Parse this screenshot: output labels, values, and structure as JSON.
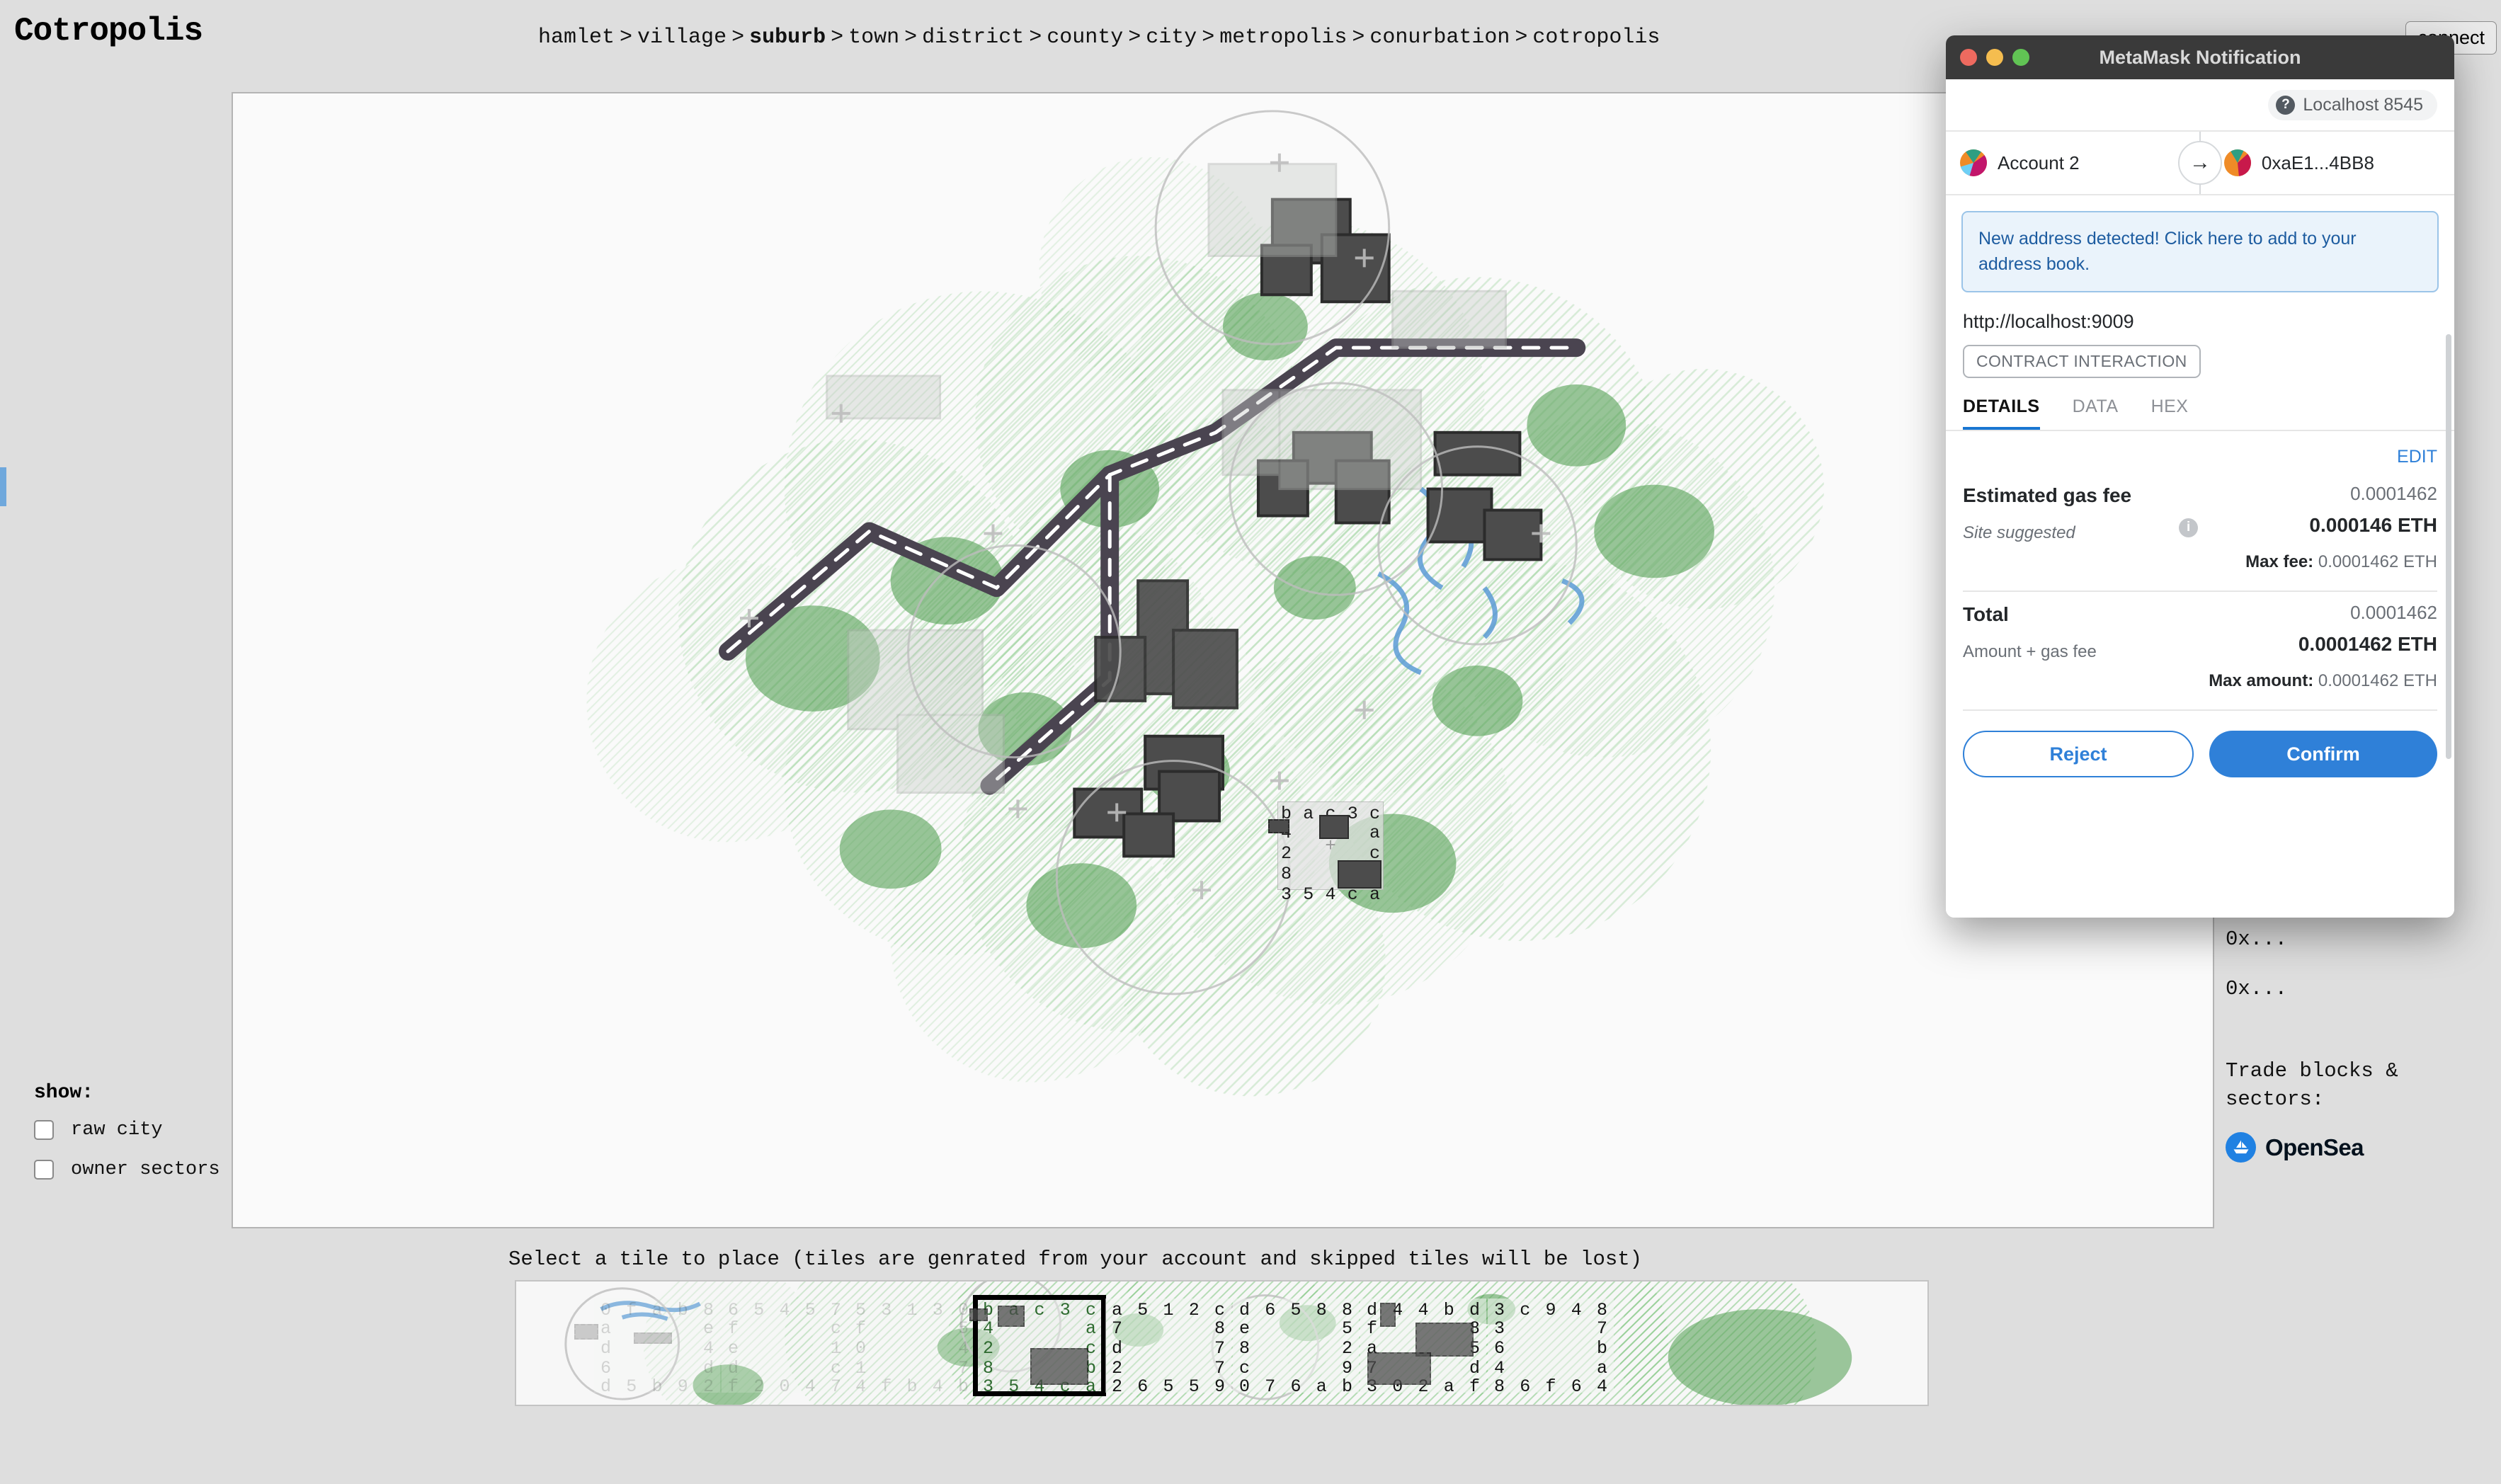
{
  "app": {
    "title": "Cotropolis",
    "connect_label": "connect"
  },
  "breadcrumb": {
    "separator": ">",
    "items": [
      {
        "label": "hamlet",
        "active": false
      },
      {
        "label": "village",
        "active": false
      },
      {
        "label": "suburb",
        "active": true
      },
      {
        "label": "town",
        "active": false
      },
      {
        "label": "district",
        "active": false
      },
      {
        "label": "county",
        "active": false
      },
      {
        "label": "city",
        "active": false
      },
      {
        "label": "metropolis",
        "active": false
      },
      {
        "label": "conurbation",
        "active": false
      },
      {
        "label": "cotropolis",
        "active": false
      }
    ]
  },
  "show_panel": {
    "label": "show:",
    "options": [
      {
        "label": "raw city",
        "checked": false
      },
      {
        "label": "owner sectors",
        "checked": false
      }
    ]
  },
  "right_sidebar": {
    "address_1": "0x...",
    "address_2": "0x...",
    "trade_label": "Trade blocks & sectors:",
    "marketplace": "OpenSea"
  },
  "map": {
    "overlay_tile": {
      "row_top": [
        "b",
        "a",
        "c",
        "3",
        "c"
      ],
      "row_2_left": "4",
      "row_2_right": "a",
      "row_3_left": "2",
      "row_3_right": "c",
      "row_4_left": "8",
      "row_4_right": "b",
      "row_bottom": [
        "3",
        "5",
        "4",
        "c",
        "a"
      ],
      "center_marker": "+"
    }
  },
  "tile_picker": {
    "hint": "Select a tile to place (tiles are genrated from your account and skipped tiles will be lost)",
    "tiles": [
      {
        "id": "tile-1",
        "state": "faded",
        "text_tone": "greytext",
        "row_top": [
          "0",
          "f",
          "a",
          "b",
          "8"
        ],
        "row_2_left": "a",
        "row_2_right": "e",
        "row_3_left": "d",
        "row_3_right": "4",
        "row_4_left": "6",
        "row_4_right": "d",
        "row_bottom": [
          "d",
          "5",
          "b",
          "9",
          "2"
        ]
      },
      {
        "id": "tile-2",
        "state": "faded",
        "text_tone": "greytext",
        "row_top": [
          "6",
          "5",
          "4",
          "5",
          "7"
        ],
        "row_2_left": "f",
        "row_2_right": "c",
        "row_3_left": "e",
        "row_3_right": "1",
        "row_4_left": "d",
        "row_4_right": "c",
        "row_bottom": [
          "f",
          "2",
          "0",
          "4",
          "7"
        ]
      },
      {
        "id": "tile-3",
        "state": "faded",
        "text_tone": "greytext",
        "row_top": [
          "5",
          "3",
          "1",
          "3",
          "0"
        ],
        "row_2_left": "f",
        "row_2_right": "5",
        "row_3_left": "0",
        "row_3_right": "4",
        "row_4_left": "1",
        "row_4_right": "7",
        "row_bottom": [
          "4",
          "f",
          "b",
          "4",
          "b"
        ]
      },
      {
        "id": "tile-4",
        "state": "selected",
        "text_tone": "greentext",
        "row_top": [
          "b",
          "a",
          "c",
          "3",
          "c"
        ],
        "row_2_left": "4",
        "row_2_right": "a",
        "row_3_left": "2",
        "row_3_right": "c",
        "row_4_left": "8",
        "row_4_right": "b",
        "row_bottom": [
          "3",
          "5",
          "4",
          "c",
          "a"
        ]
      },
      {
        "id": "tile-5",
        "state": "normal",
        "text_tone": "darktext",
        "row_top": [
          "a",
          "5",
          "1",
          "2",
          "c"
        ],
        "row_2_left": "7",
        "row_2_right": "8",
        "row_3_left": "d",
        "row_3_right": "7",
        "row_4_left": "2",
        "row_4_right": "7",
        "row_bottom": [
          "2",
          "6",
          "5",
          "5",
          "9"
        ]
      },
      {
        "id": "tile-6",
        "state": "normal",
        "text_tone": "darktext",
        "row_top": [
          "d",
          "6",
          "5",
          "8",
          "8"
        ],
        "row_2_left": "e",
        "row_2_right": "5",
        "row_3_left": "8",
        "row_3_right": "2",
        "row_4_left": "c",
        "row_4_right": "9",
        "row_bottom": [
          "0",
          "7",
          "6",
          "a",
          "b"
        ]
      },
      {
        "id": "tile-7",
        "state": "normal",
        "text_tone": "darktext",
        "row_top": [
          "d",
          "4",
          "4",
          "b",
          "d"
        ],
        "row_2_left": "f",
        "row_2_right": "8",
        "row_3_left": "a",
        "row_3_right": "5",
        "row_4_left": "7",
        "row_4_right": "d",
        "row_bottom": [
          "3",
          "0",
          "2",
          "a",
          "f"
        ]
      },
      {
        "id": "tile-8",
        "state": "normal",
        "text_tone": "darktext",
        "row_top": [
          "3",
          "c",
          "9",
          "4",
          "8"
        ],
        "row_2_left": "3",
        "row_2_right": "7",
        "row_3_left": "6",
        "row_3_right": "b",
        "row_4_left": "4",
        "row_4_right": "a",
        "row_bottom": [
          "8",
          "6",
          "f",
          "6",
          "4"
        ]
      }
    ]
  },
  "metamask": {
    "window_title": "MetaMask Notification",
    "network": "Localhost 8545",
    "network_icon": "?",
    "from_account": "Account 2",
    "to_account": "0xaE1...4BB8",
    "transfer_arrow": "→",
    "banner": "New address detected! Click here to add to your address book.",
    "origin": "http://localhost:9009",
    "type_badge": "CONTRACT INTERACTION",
    "tabs": [
      {
        "label": "DETAILS",
        "active": true
      },
      {
        "label": "DATA",
        "active": false
      },
      {
        "label": "HEX",
        "active": false
      }
    ],
    "edit_label": "EDIT",
    "gas": {
      "title": "Estimated gas fee",
      "subtitle": "Site suggested",
      "approx": "0.0001462",
      "amount": "0.000146 ETH",
      "max_label": "Max fee:",
      "max_value": "0.0001462 ETH",
      "info_icon": "i"
    },
    "total": {
      "title": "Total",
      "subtitle": "Amount + gas fee",
      "approx": "0.0001462",
      "amount": "0.0001462 ETH",
      "max_label": "Max amount:",
      "max_value": "0.0001462 ETH"
    },
    "reject_label": "Reject",
    "confirm_label": "Confirm"
  },
  "colors": {
    "accent_blue": "#2f80d8",
    "banner_blue": "#1d5ca0",
    "opensea_blue": "#2081e2",
    "page_bg": "#dedede",
    "map_bg": "#fafafa"
  }
}
